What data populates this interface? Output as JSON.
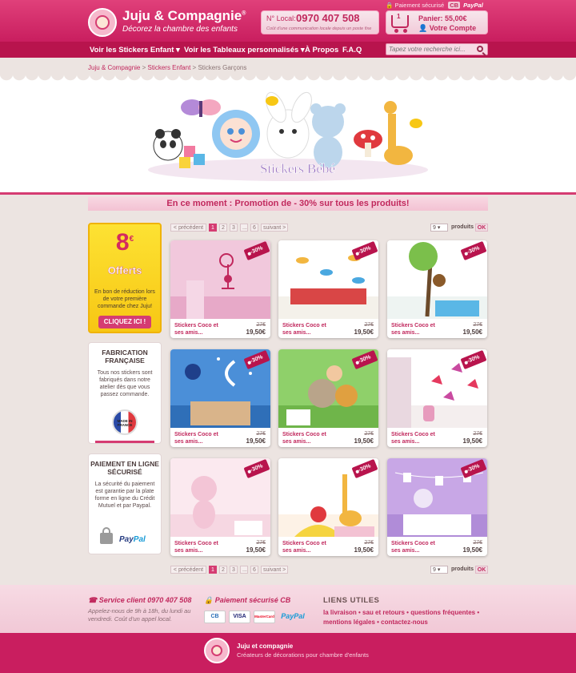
{
  "header": {
    "brand_name": "Juju & Compagnie",
    "brand_reg": "®",
    "tagline": "Décorez la chambre des enfants",
    "phone_label": "N° Local:",
    "phone_number": "0970 407 508",
    "phone_note": "Coût d'une communication locale depuis un poste fixe",
    "secure_text": "Paiement sécurisé",
    "secure_cb": "CB",
    "secure_paypal": "PayPal",
    "cart_count": "1",
    "cart_total": "Panier: 55,00€",
    "account_label": "Votre Compte"
  },
  "nav": {
    "items": [
      "Voir les Stickers Enfant ▾",
      "Voir les Tableaux personnalisés ▾",
      "À Propos",
      "F.A.Q"
    ],
    "search_placeholder": "Tapez votre recherche ici..."
  },
  "breadcrumb": {
    "items": [
      "Juju & Compagnie",
      "Stickers Enfant",
      "Stickers Garçons"
    ],
    "separator": " > "
  },
  "banner": {
    "title": "Stickers Bébé"
  },
  "promo_banner": "En ce moment : Promotion de - 30% sur tous les produits!",
  "pagination": {
    "prev": "< précédent",
    "pages": [
      "1",
      "2",
      "3",
      "...",
      "6"
    ],
    "next": "suivant >",
    "per_page_value": "9",
    "per_page_label": "produits",
    "ok": "OK"
  },
  "sidebar": {
    "promo": {
      "amount": "8",
      "currency": "€",
      "label": "Offerts",
      "text": "En bon de réduction lors de votre première commande chez Juju!",
      "button": "CLIQUEZ ICI !"
    },
    "fabrication": {
      "title": "FABRICATION FRANÇAISE",
      "text": "Tous nos stickers sont fabriqués dans notre atelier dès que vous passez commande.",
      "badge": "MADE IN FRANCE"
    },
    "payment": {
      "title": "PAIEMENT EN LIGNE SÉCURISÉ",
      "text": "La sécurité du paiement est garantie par la plate forme en ligne du Crédit Mutuel et par Paypal.",
      "paypal_a": "Pay",
      "paypal_b": "Pal"
    }
  },
  "products": [
    {
      "name": "Stickers Coco et ses amis...",
      "old_price": "27€",
      "price": "19,50€",
      "tag": "-30%"
    },
    {
      "name": "Stickers Coco et ses amis...",
      "old_price": "27€",
      "price": "19,50€",
      "tag": "-30%"
    },
    {
      "name": "Stickers Coco et ses amis...",
      "old_price": "27€",
      "price": "19,50€",
      "tag": "-30%"
    },
    {
      "name": "Stickers Coco et ses amis...",
      "old_price": "27€",
      "price": "19,50€",
      "tag": "-30%"
    },
    {
      "name": "Stickers Coco et ses amis...",
      "old_price": "27€",
      "price": "19,50€",
      "tag": "-30%"
    },
    {
      "name": "Stickers Coco et ses amis...",
      "old_price": "27€",
      "price": "19,50€",
      "tag": "-30%"
    },
    {
      "name": "Stickers Coco et ses amis...",
      "old_price": "27€",
      "price": "19,50€",
      "tag": "-30%"
    },
    {
      "name": "Stickers Coco et ses amis...",
      "old_price": "27€",
      "price": "19,50€",
      "tag": "-30%"
    },
    {
      "name": "Stickers Coco et ses amis...",
      "old_price": "27€",
      "price": "19,50€",
      "tag": "-30%"
    }
  ],
  "footer": {
    "service_title": "Service client 0970 407 508",
    "service_text": "Appelez-nous de 9h à 18h, du lundi au vendredi. Coût d'un appel local.",
    "payment_title": "Paiement sécurisé CB",
    "cards": [
      "CB",
      "VISA",
      "MasterCard",
      "PayPal"
    ],
    "links_title": "LIENS UTILES",
    "links": [
      "la livraison",
      "sau et retours",
      "questions fréquentes",
      "mentions légales",
      "contactez-nous"
    ],
    "bottom_name": "Juju et compagnie",
    "bottom_desc": "Créateurs de décorations pour chambre d'enfants"
  }
}
